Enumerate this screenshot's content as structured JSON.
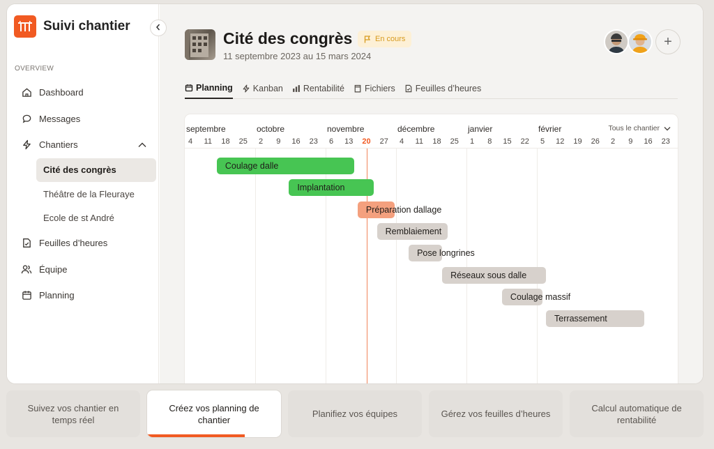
{
  "brand": {
    "name": "Suivi chantier"
  },
  "sidebar": {
    "section_label": "OVERVIEW",
    "items": [
      {
        "label": "Dashboard",
        "icon": "home-icon"
      },
      {
        "label": "Messages",
        "icon": "chat-icon"
      },
      {
        "label": "Chantiers",
        "icon": "bolt-icon"
      }
    ],
    "projects": [
      {
        "label": "Cité des congrès",
        "active": true
      },
      {
        "label": "Théâtre de la Fleuraye",
        "active": false
      },
      {
        "label": "Ecole de st André",
        "active": false
      }
    ],
    "items_after": [
      {
        "label": "Feuilles d’heures",
        "icon": "timesheet-icon"
      },
      {
        "label": "Équipe",
        "icon": "team-icon"
      },
      {
        "label": "Planning",
        "icon": "calendar-icon"
      }
    ]
  },
  "project": {
    "title": "Cité des congrès",
    "status": "En cours",
    "dates": "11 septembre 2023 au 15 mars 2024"
  },
  "tabs": [
    {
      "label": "Planning",
      "icon": "calendar-icon",
      "active": true
    },
    {
      "label": "Kanban",
      "icon": "bolt-icon",
      "active": false
    },
    {
      "label": "Rentabilité",
      "icon": "bar-chart-icon",
      "active": false
    },
    {
      "label": "Fichiers",
      "icon": "folder-icon",
      "active": false
    },
    {
      "label": "Feuilles d’heures",
      "icon": "timesheet-icon",
      "active": false
    }
  ],
  "gantt": {
    "filter": "Tous le chantier",
    "months": [
      "septembre",
      "octobre",
      "novembre",
      "décembre",
      "janvier",
      "février"
    ],
    "ticks": [
      "4",
      "11",
      "18",
      "25",
      "2",
      "9",
      "16",
      "23",
      "6",
      "13",
      "20",
      "27",
      "4",
      "11",
      "18",
      "25",
      "1",
      "8",
      "15",
      "22",
      "5",
      "12",
      "19",
      "26",
      "2",
      "9",
      "16",
      "23"
    ],
    "today_index": 10,
    "tasks": [
      {
        "label": "Coulage dalle",
        "start": 1.5,
        "end": 9.3,
        "color": "#47c553"
      },
      {
        "label": "Implantation",
        "start": 5.6,
        "end": 10.4,
        "color": "#47c553"
      },
      {
        "label": "Préparation dallage",
        "start": 9.5,
        "end": 11.6,
        "color": "#f4a07e"
      },
      {
        "label": "Remblaiement",
        "start": 10.6,
        "end": 14.6,
        "color": "#d7d1cc"
      },
      {
        "label": "Pose longrines",
        "start": 12.4,
        "end": 14.3,
        "color": "#d7d1cc"
      },
      {
        "label": "Réseaux sous dalle",
        "start": 14.3,
        "end": 20.2,
        "color": "#d7d1cc"
      },
      {
        "label": "Coulage massif",
        "start": 17.7,
        "end": 20.0,
        "color": "#d7d1cc"
      },
      {
        "label": "Terrassement",
        "start": 20.2,
        "end": 25.8,
        "color": "#d7d1cc"
      }
    ]
  },
  "footer_tabs": [
    {
      "label": "Suivez vos chantier en temps réel",
      "active": false
    },
    {
      "label": "Créez vos planning de chantier",
      "active": true,
      "progress": 0.73
    },
    {
      "label": "Planifiez vos équipes",
      "active": false
    },
    {
      "label": "Gérez vos feuilles d’heures",
      "active": false
    },
    {
      "label": "Calcul automatique de rentabilité",
      "active": false
    }
  ]
}
